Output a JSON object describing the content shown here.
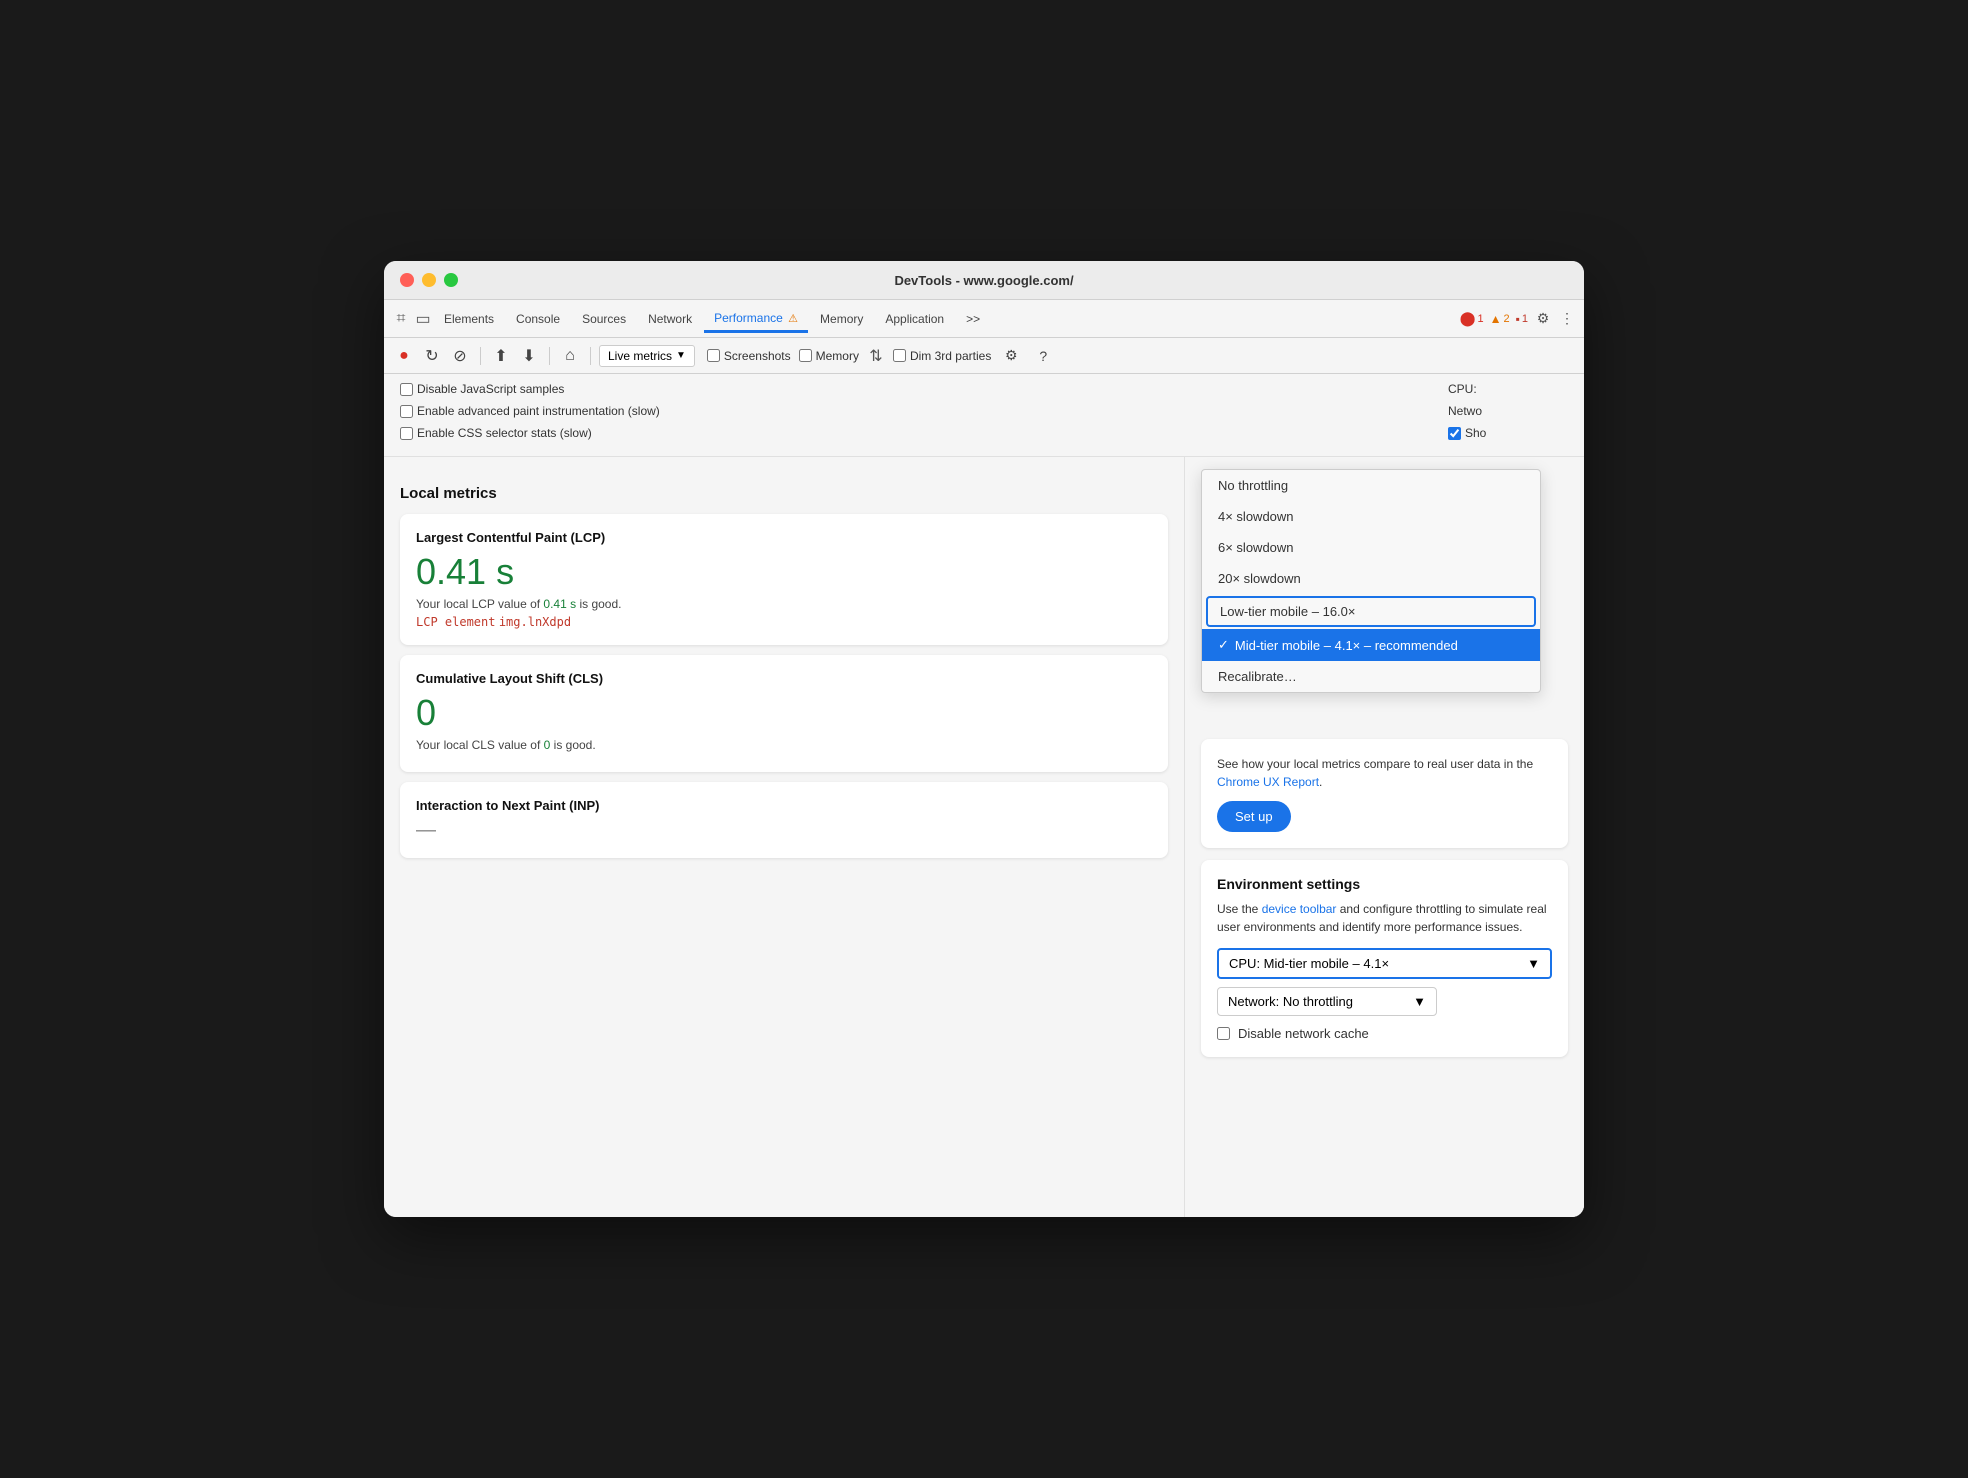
{
  "window": {
    "title": "DevTools - www.google.com/"
  },
  "tabs": {
    "items": [
      {
        "label": "Elements",
        "active": false
      },
      {
        "label": "Console",
        "active": false
      },
      {
        "label": "Sources",
        "active": false
      },
      {
        "label": "Network",
        "active": false
      },
      {
        "label": "Performance",
        "active": true
      },
      {
        "label": "Memory",
        "active": false
      },
      {
        "label": "Application",
        "active": false
      },
      {
        "label": ">>",
        "active": false
      }
    ],
    "errors": {
      "count": "1",
      "icon": "●"
    },
    "warnings": {
      "count": "2",
      "icon": "▲"
    },
    "info": {
      "count": "1",
      "icon": "■"
    }
  },
  "toolbar": {
    "record_label": "●",
    "refresh_label": "↻",
    "stop_label": "⊘",
    "upload_label": "↑",
    "download_label": "↓",
    "home_label": "⌂",
    "live_metrics_label": "Live metrics",
    "screenshots_label": "Screenshots",
    "memory_label": "Memory",
    "dim_parties_label": "Dim 3rd parties",
    "settings_label": "⚙",
    "help_label": "?"
  },
  "settings_checkboxes": {
    "disable_js_label": "Disable JavaScript samples",
    "enable_paint_label": "Enable advanced paint instrumentation (slow)",
    "enable_css_label": "Enable CSS selector stats (slow)",
    "cpu_label": "CPU:",
    "network_label": "Netwo",
    "show_label": "Sho"
  },
  "dropdown": {
    "items": [
      {
        "label": "No throttling",
        "selected": false,
        "highlighted": false
      },
      {
        "label": "4× slowdown",
        "selected": false,
        "highlighted": false
      },
      {
        "label": "6× slowdown",
        "selected": false,
        "highlighted": false
      },
      {
        "label": "20× slowdown",
        "selected": false,
        "highlighted": false
      },
      {
        "label": "Low-tier mobile – 16.0×",
        "selected": false,
        "highlighted": true
      },
      {
        "label": "Mid-tier mobile – 4.1× – recommended",
        "selected": true,
        "highlighted": false
      },
      {
        "label": "Recalibrate…",
        "selected": false,
        "highlighted": false
      }
    ]
  },
  "local_metrics": {
    "title": "Local metrics",
    "lcp": {
      "title": "Largest Contentful Paint (LCP)",
      "value": "0.41 s",
      "description_prefix": "Your local LCP value of ",
      "description_value": "0.41 s",
      "description_suffix": " is good.",
      "element_prefix": "LCP element",
      "element_value": "img.lnXdpd"
    },
    "cls": {
      "title": "Cumulative Layout Shift (CLS)",
      "value": "0",
      "description_prefix": "Your local CLS value of ",
      "description_value": "0",
      "description_suffix": " is good."
    },
    "inp": {
      "title": "Interaction to Next Paint (INP)",
      "value": "—"
    }
  },
  "ux_report": {
    "text_before": "See how your local metrics compare to real user data in the ",
    "link_text": "Chrome UX Report",
    "text_after": ".",
    "setup_button": "Set up"
  },
  "env_settings": {
    "title": "Environment settings",
    "description_before": "Use the ",
    "link_text": "device toolbar",
    "description_after": " and configure throttling to simulate real user environments and identify more performance issues.",
    "cpu_select_label": "CPU: Mid-tier mobile – 4.1×",
    "network_select_label": "Network: No throttling",
    "disable_cache_label": "Disable network cache"
  }
}
